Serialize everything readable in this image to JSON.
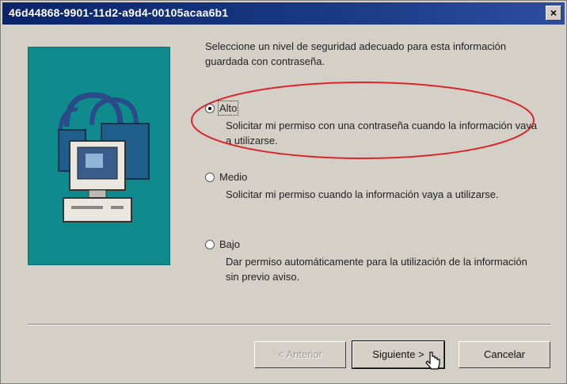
{
  "window": {
    "title": "46d44868-9901-11d2-a9d4-00105acaa6b1",
    "close_label": "×"
  },
  "intro_text": "Seleccione un nivel de seguridad adecuado para esta información guardada con contraseña.",
  "options": [
    {
      "label": "Alto",
      "description": "Solicitar mi permiso con una contraseña cuando la información vaya a utilizarse.",
      "selected": true
    },
    {
      "label": "Medio",
      "description": "Solicitar mi permiso cuando la información vaya a utilizarse.",
      "selected": false
    },
    {
      "label": "Bajo",
      "description": "Dar permiso automáticamente para la utilización de la información sin previo aviso.",
      "selected": false
    }
  ],
  "buttons": {
    "back": "< Anterior",
    "next": "Siguiente >",
    "cancel": "Cancelar"
  },
  "colors": {
    "titlebar": "#0a246a",
    "panel": "#0f8b8d",
    "annotation": "#d9262a",
    "face": "#d4d0c8"
  },
  "icons": {
    "panel": "padlock-computer-icon",
    "cursor": "mouse-pointer-icon"
  }
}
